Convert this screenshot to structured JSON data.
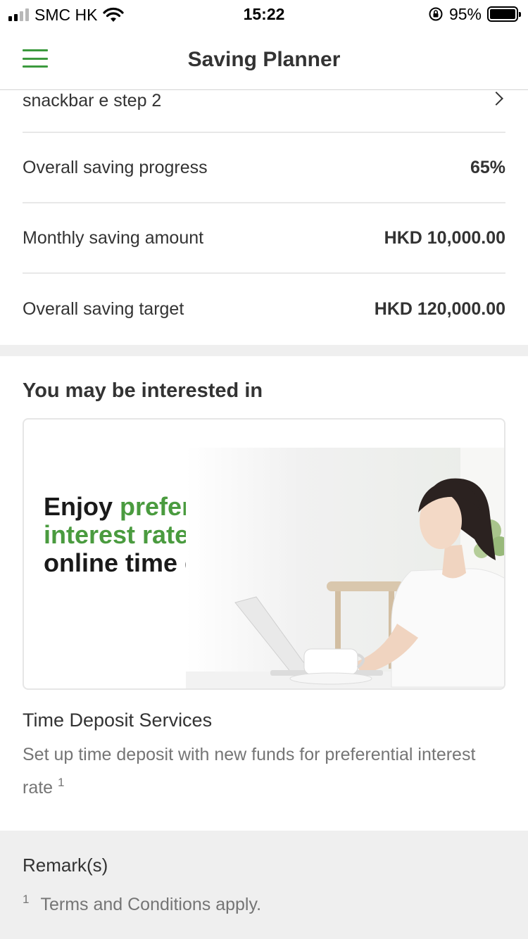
{
  "status_bar": {
    "carrier": "SMC HK",
    "time": "15:22",
    "battery_percent": "95%"
  },
  "header": {
    "title": "Saving Planner"
  },
  "plan": {
    "name": "snackbar e step 2",
    "rows": [
      {
        "label": "Overall saving progress",
        "value": "65%"
      },
      {
        "label": "Monthly saving amount",
        "value": "HKD 10,000.00"
      },
      {
        "label": "Overall saving target",
        "value": "HKD 120,000.00"
      }
    ]
  },
  "interest": {
    "section_title": "You may be interested in",
    "banner": {
      "text_1": "Enjoy ",
      "text_highlight": "preferential interest rates",
      "text_2": " for online time deposit"
    },
    "service_title": "Time Deposit Services",
    "service_desc": "Set up time deposit with new funds for preferential interest rate",
    "service_sup": "1"
  },
  "remarks": {
    "title": "Remark(s)",
    "items": [
      {
        "num": "1",
        "text": "Terms and Conditions apply."
      }
    ]
  },
  "colors": {
    "accent_green": "#4a9b3f",
    "menu_green": "#3c9a3e",
    "section_bg": "#efefef"
  }
}
